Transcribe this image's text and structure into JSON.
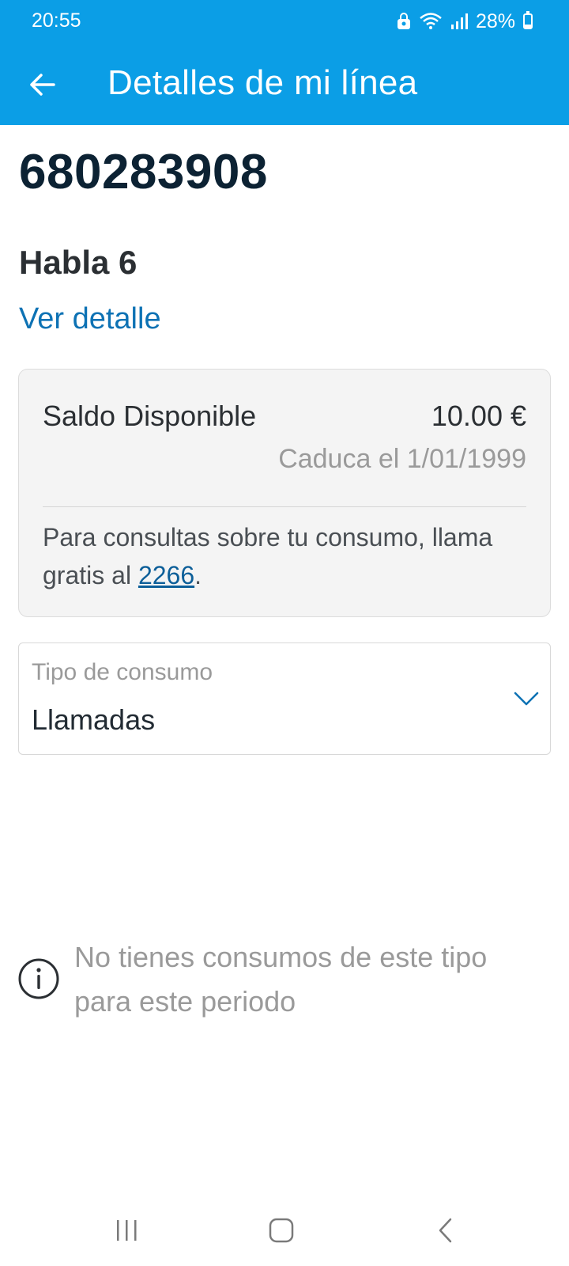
{
  "status_bar": {
    "time": "20:55",
    "battery": "28%",
    "battery_level": 0.28
  },
  "header": {
    "title": "Detalles de mi línea",
    "back_icon": "arrow-left-icon",
    "background": "#0b9ee6"
  },
  "line": {
    "number": "680283908",
    "plan": "Habla 6",
    "detail_link": "Ver detalle"
  },
  "balance": {
    "label": "Saldo Disponible",
    "amount": "10.00 €",
    "expiry": "Caduca el 1/01/1999",
    "consult_text": "Para consultas sobre tu consumo, llama gratis al ",
    "phone": "2266",
    "consult_end": "."
  },
  "consumption_select": {
    "label": "Tipo de consumo",
    "value": "Llamadas",
    "icon": "chevron-down-icon"
  },
  "empty_state": {
    "icon": "info-icon",
    "message": "No tienes consumos de este tipo para este periodo"
  },
  "colors": {
    "accent": "#0b9ee6",
    "link": "#0d72b4",
    "muted": "#9a9a9a"
  }
}
